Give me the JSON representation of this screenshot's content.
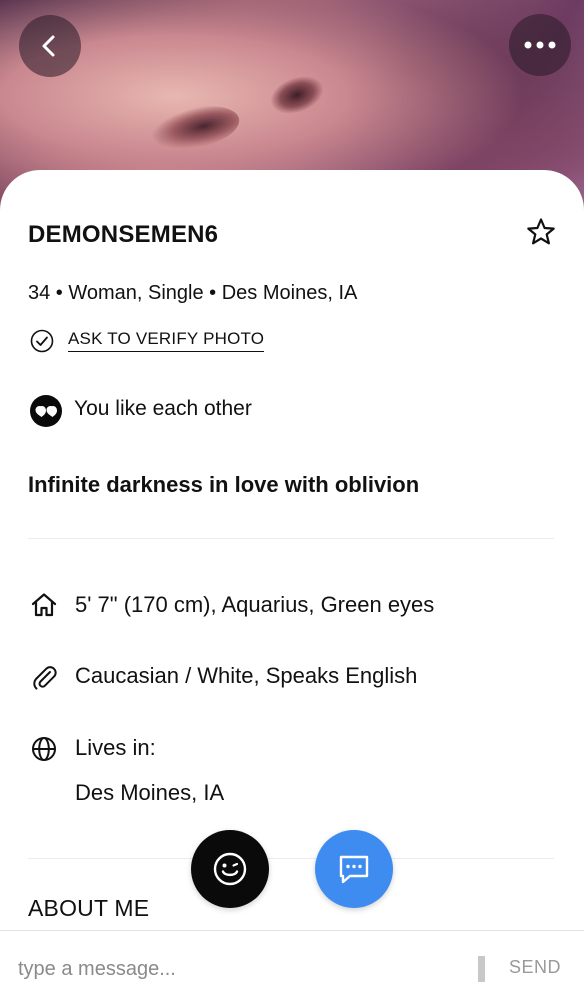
{
  "profile": {
    "username": "DEMONSEMEN6",
    "meta": "34 • Woman, Single • Des Moines, IA",
    "verify_label": "ASK TO VERIFY PHOTO",
    "mutual_label": "You like each other",
    "headline": "Infinite darkness in love with oblivion"
  },
  "details": {
    "basics": "5' 7\" (170 cm), Aquarius, Green eyes",
    "background": "Caucasian / White, Speaks English",
    "lives_in_label": "Lives in:",
    "lives_in_value": "Des Moines, IA"
  },
  "sections": {
    "about_title": "ABOUT ME"
  },
  "composer": {
    "placeholder": "type a message...",
    "send_label": "SEND"
  },
  "colors": {
    "accent_blue": "#3e8cf0",
    "dark_fab": "#0a0a0a"
  },
  "icons": [
    "back-icon",
    "more-icon",
    "star-icon",
    "verified-check-icon",
    "mutual-like-icon",
    "home-icon",
    "paperclip-icon",
    "globe-icon",
    "smiley-icon",
    "chat-icon"
  ]
}
